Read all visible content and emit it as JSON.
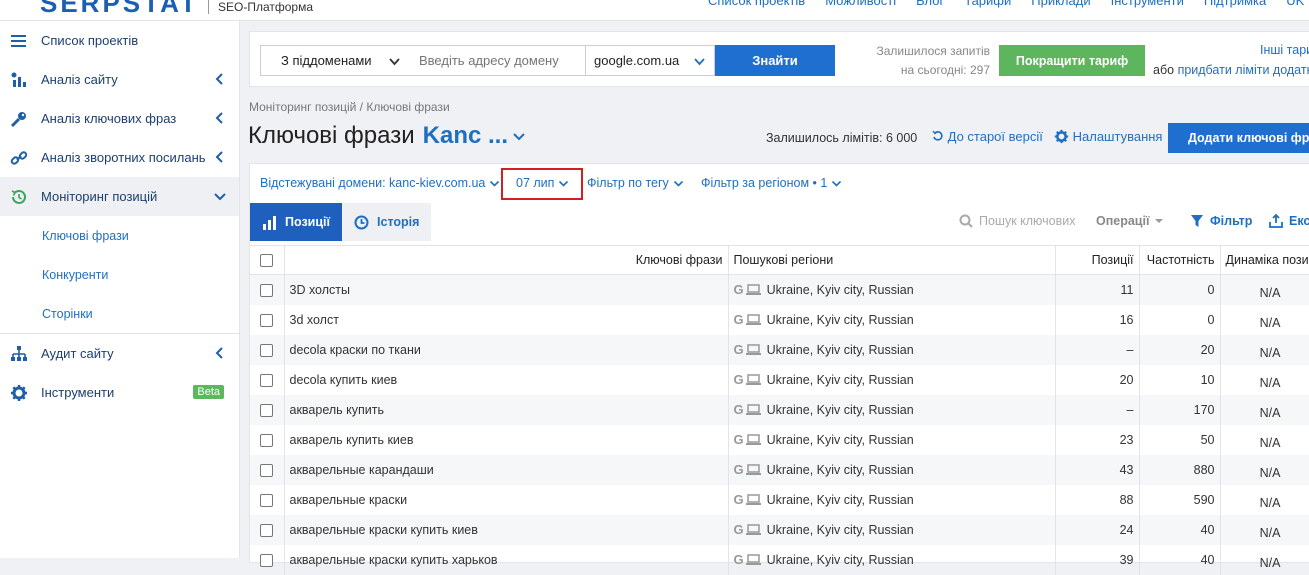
{
  "app": {
    "logo": "SERPSTAT",
    "subtitle": "SEO-Платформа"
  },
  "topnav": [
    "Список проектів",
    "Можливості",
    "Блог",
    "Тарифи",
    "Приклади",
    "Інструменти",
    "Підтримка",
    "UK"
  ],
  "sidebar": {
    "items": [
      {
        "label": "Список проектів",
        "icon": "menu-icon"
      },
      {
        "label": "Аналіз сайту",
        "icon": "site-analysis-icon"
      },
      {
        "label": "Аналіз ключових фраз",
        "icon": "key-icon"
      },
      {
        "label": "Аналіз зворотних посилань",
        "icon": "link-icon"
      },
      {
        "label": "Моніторинг позицій",
        "icon": "monitoring-icon"
      }
    ],
    "subitems": [
      "Ключові фрази",
      "Конкуренти",
      "Сторінки"
    ],
    "bottom": [
      {
        "label": "Аудит сайту",
        "icon": "audit-icon"
      },
      {
        "label": "Інструменти",
        "icon": "gear-icon",
        "badge": "Beta"
      }
    ]
  },
  "search": {
    "mode": "З піддоменами",
    "placeholder": "Введіть адресу домену",
    "engine": "google.com.ua",
    "find": "Знайти",
    "limits_line1": "Залишилося запитів",
    "limits_line2": "на сьогодні: 297",
    "upgrade": "Покращити тариф",
    "other": "Інші тари",
    "or": "або",
    "buy": "придбати ліміти додатко"
  },
  "breadcrumb": "Моніторинг позицій / Ключові фрази",
  "title": "Ключові фрази",
  "project": "Kanc ...",
  "limits_left": "Залишилось лімітів: 6 000",
  "old_version": "До старої версії",
  "settings": "Налаштування",
  "add_keywords": "Додати ключові фраз",
  "filters": {
    "domains": "Відстежувані домени: kanc-kiev.com.ua",
    "date": "07 лип",
    "tag": "Фільтр по тегу",
    "region": "Фільтр за регіоном • 1"
  },
  "tabs": {
    "positions": "Позиції",
    "history": "Історія"
  },
  "toolbar": {
    "search_placeholder": "Пошук ключових",
    "operations": "Операції",
    "filter": "Фільтр",
    "export": "Екс"
  },
  "table": {
    "headers": [
      "Ключові фрази",
      "Пошукові регіони",
      "Позиції",
      "Частотність",
      "Динаміка пози"
    ],
    "rows": [
      {
        "kw": "3D холсты",
        "region": "Ukraine, Kyiv city, Russian",
        "pos": "11",
        "freq": "0",
        "dyn": "N/A"
      },
      {
        "kw": "3d холст",
        "region": "Ukraine, Kyiv city, Russian",
        "pos": "16",
        "freq": "0",
        "dyn": "N/A"
      },
      {
        "kw": "decola краски по ткани",
        "region": "Ukraine, Kyiv city, Russian",
        "pos": "–",
        "freq": "20",
        "dyn": "N/A"
      },
      {
        "kw": "decola купить киев",
        "region": "Ukraine, Kyiv city, Russian",
        "pos": "20",
        "freq": "10",
        "dyn": "N/A"
      },
      {
        "kw": "акварель купить",
        "region": "Ukraine, Kyiv city, Russian",
        "pos": "–",
        "freq": "170",
        "dyn": "N/A"
      },
      {
        "kw": "акварель купить киев",
        "region": "Ukraine, Kyiv city, Russian",
        "pos": "23",
        "freq": "50",
        "dyn": "N/A"
      },
      {
        "kw": "акварельные карандаши",
        "region": "Ukraine, Kyiv city, Russian",
        "pos": "43",
        "freq": "880",
        "dyn": "N/A"
      },
      {
        "kw": "акварельные краски",
        "region": "Ukraine, Kyiv city, Russian",
        "pos": "88",
        "freq": "590",
        "dyn": "N/A"
      },
      {
        "kw": "акварельные краски купить киев",
        "region": "Ukraine, Kyiv city, Russian",
        "pos": "24",
        "freq": "40",
        "dyn": "N/A"
      },
      {
        "kw": "акварельные краски купить харьков",
        "region": "Ukraine, Kyiv city, Russian",
        "pos": "39",
        "freq": "40",
        "dyn": "N/A"
      }
    ]
  },
  "colors": {
    "brand": "#1f6fd0",
    "upgrade": "#5db55d",
    "highlight": "#d0201f"
  }
}
